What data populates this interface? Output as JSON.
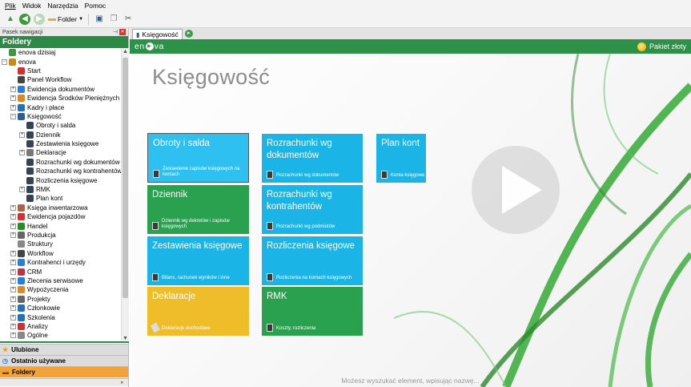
{
  "menu": [
    "Plik",
    "Widok",
    "Narzędzia",
    "Pomoc"
  ],
  "toolbar": {
    "folder_label": "Folder"
  },
  "nav": {
    "pane_title": "Pasek nawigacji",
    "folders_title": "Foldery"
  },
  "tree": [
    {
      "label": "enova dzisiaj",
      "level": 0,
      "exp": "",
      "icon": "globe-icon",
      "color": "#3a9a3a"
    },
    {
      "label": "enova",
      "level": 0,
      "exp": "−",
      "icon": "database-icon",
      "color": "#d08a00"
    },
    {
      "label": "Start",
      "level": 1,
      "exp": "",
      "icon": "calendar-icon",
      "color": "#c33"
    },
    {
      "label": "Panel Workflow",
      "level": 1,
      "exp": "",
      "icon": "workflow-icon",
      "color": "#444"
    },
    {
      "label": "Ewidencja dokumentów",
      "level": 1,
      "exp": "+",
      "icon": "documents-icon",
      "color": "#2a7fd4"
    },
    {
      "label": "Ewidencja Środków Pieniężnych",
      "level": 1,
      "exp": "+",
      "icon": "money-icon",
      "color": "#d9892a"
    },
    {
      "label": "Kadry i płace",
      "level": 1,
      "exp": "+",
      "icon": "people-icon",
      "color": "#2a6fb0"
    },
    {
      "label": "Księgowość",
      "level": 1,
      "exp": "−",
      "icon": "book-icon",
      "color": "#2a5f8f"
    },
    {
      "label": "Obroty i salda",
      "level": 2,
      "exp": "",
      "icon": "ledger-icon",
      "color": "#345"
    },
    {
      "label": "Dziennik",
      "level": 2,
      "exp": "+",
      "icon": "ledger-icon",
      "color": "#345"
    },
    {
      "label": "Zestawienia księgowe",
      "level": 2,
      "exp": "",
      "icon": "ledger-icon",
      "color": "#345"
    },
    {
      "label": "Deklaracje",
      "level": 2,
      "exp": "+",
      "icon": "declaration-icon",
      "color": "#777"
    },
    {
      "label": "Rozrachunki wg dokumentów",
      "level": 2,
      "exp": "",
      "icon": "ledger-icon",
      "color": "#345"
    },
    {
      "label": "Rozrachunki wg kontrahentów",
      "level": 2,
      "exp": "",
      "icon": "ledger-icon",
      "color": "#345"
    },
    {
      "label": "Rozliczenia księgowe",
      "level": 2,
      "exp": "",
      "icon": "ledger-icon",
      "color": "#345"
    },
    {
      "label": "RMK",
      "level": 2,
      "exp": "+",
      "icon": "ledger-icon",
      "color": "#345"
    },
    {
      "label": "Plan kont",
      "level": 2,
      "exp": "",
      "icon": "ledger-icon",
      "color": "#345"
    },
    {
      "label": "Księga inwentarzowa",
      "level": 1,
      "exp": "+",
      "icon": "inventory-icon",
      "color": "#a64"
    },
    {
      "label": "Ewidencja pojazdów",
      "level": 1,
      "exp": "+",
      "icon": "car-icon",
      "color": "#c33"
    },
    {
      "label": "Handel",
      "level": 1,
      "exp": "+",
      "icon": "cart-icon",
      "color": "#2a8a2a"
    },
    {
      "label": "Produkcja",
      "level": 1,
      "exp": "+",
      "icon": "factory-icon",
      "color": "#666"
    },
    {
      "label": "Struktury",
      "level": 1,
      "exp": "",
      "icon": "structure-icon",
      "color": "#888"
    },
    {
      "label": "Workflow",
      "level": 1,
      "exp": "+",
      "icon": "workflow-icon",
      "color": "#444"
    },
    {
      "label": "Kontrahenci i urzędy",
      "level": 1,
      "exp": "+",
      "icon": "contacts-icon",
      "color": "#2a7fd4"
    },
    {
      "label": "CRM",
      "level": 1,
      "exp": "+",
      "icon": "crm-icon",
      "color": "#b34"
    },
    {
      "label": "Zlecenia serwisowe",
      "level": 1,
      "exp": "+",
      "icon": "wrench-icon",
      "color": "#2a7fd4"
    },
    {
      "label": "Wypożyczenia",
      "level": 1,
      "exp": "+",
      "icon": "rental-icon",
      "color": "#d9892a"
    },
    {
      "label": "Projekty",
      "level": 1,
      "exp": "+",
      "icon": "project-icon",
      "color": "#666"
    },
    {
      "label": "Członkowie",
      "level": 1,
      "exp": "+",
      "icon": "members-icon",
      "color": "#2a6fb0"
    },
    {
      "label": "Szkolenia",
      "level": 1,
      "exp": "+",
      "icon": "training-icon",
      "color": "#2a6fb0"
    },
    {
      "label": "Analizy",
      "level": 1,
      "exp": "+",
      "icon": "chart-icon",
      "color": "#c33"
    },
    {
      "label": "Ogólne",
      "level": 1,
      "exp": "+",
      "icon": "general-icon",
      "color": "#888"
    }
  ],
  "bottom": {
    "ulubione": "Ulubione",
    "ostatnio": "Ostatnio używane",
    "foldery": "Foldery"
  },
  "tab": {
    "label": "Księgowość"
  },
  "header": {
    "logo_left": "en",
    "logo_right": "va",
    "pakiet": "Pakiet złoty"
  },
  "page_title": "Księgowość",
  "tiles": [
    {
      "id": "obroty",
      "title": "Obroty i salda",
      "sub": "Zestawienie zapisów księgowych na kontach",
      "color": "sel"
    },
    {
      "id": "dziennik",
      "title": "Dziennik",
      "sub": "Dziennik wg dekretów i zapisów księgowych",
      "color": "green"
    },
    {
      "id": "zestawienia",
      "title": "Zestawienia księgowe",
      "sub": "Bilans, rachunek wyników i inne",
      "color": "blue"
    },
    {
      "id": "deklaracje",
      "title": "Deklaracje",
      "sub": "Deklaracje dochodowe",
      "color": "yellow"
    },
    {
      "id": "rozrach_dok",
      "title": "Rozrachunki wg dokumentów",
      "sub": "Rozrachunki wg dokumentów",
      "color": "blue"
    },
    {
      "id": "rozrach_kontr",
      "title": "Rozrachunki wg kontrahentów",
      "sub": "Rozrachunki wg podmiotów",
      "color": "blue"
    },
    {
      "id": "rozliczenia",
      "title": "Rozliczenia księgowe",
      "sub": "Rozliczenia na kontach księgowych",
      "color": "blue"
    },
    {
      "id": "rmk",
      "title": "RMK",
      "sub": "Koszty, rozliczenia",
      "color": "green"
    },
    {
      "id": "plan",
      "title": "Plan kont",
      "sub": "Konta księgowe",
      "color": "blue"
    }
  ],
  "search_hint": "Możesz wyszukać element, wpisując nazwę..."
}
